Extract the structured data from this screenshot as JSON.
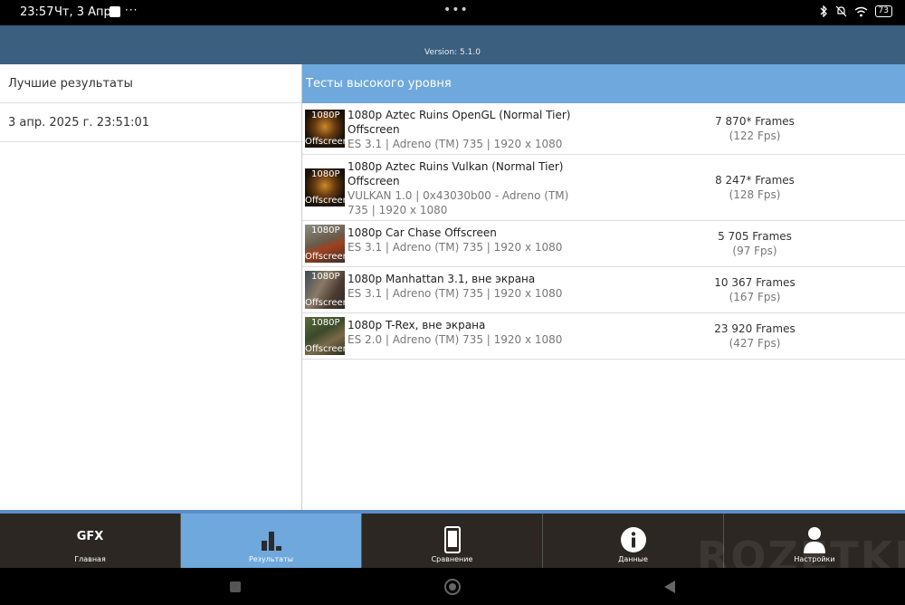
{
  "statusbar": {
    "time": "23:57",
    "date": "Чт, 3 Апр",
    "more": "···",
    "dots": "•••",
    "battery": "73"
  },
  "header": {
    "version": "Version: 5.1.0"
  },
  "left": {
    "title": "Лучшие результаты",
    "date": "3 апр. 2025 г. 23:51:01"
  },
  "right": {
    "title": "Тесты высокого уровня",
    "tests": [
      {
        "thumb_top": "1080P",
        "thumb_bottom": "Offscreen",
        "name": "1080p Aztec Ruins OpenGL (Normal Tier) Offscreen",
        "sub": "ES 3.1 | Adreno (TM) 735 | 1920 x 1080",
        "frames": "7 870* Frames",
        "fps": "(122 Fps)"
      },
      {
        "thumb_top": "1080P",
        "thumb_bottom": "Offscreen",
        "name": "1080p Aztec Ruins Vulkan (Normal Tier) Offscreen",
        "sub": "VULKAN 1.0 | 0x43030b00 - Adreno (TM) 735 | 1920 x 1080",
        "frames": "8 247* Frames",
        "fps": "(128 Fps)"
      },
      {
        "thumb_top": "1080P",
        "thumb_bottom": "Offscreen",
        "name": "1080p Car Chase Offscreen",
        "sub": "ES 3.1 | Adreno (TM) 735 | 1920 x 1080",
        "frames": "5 705 Frames",
        "fps": "(97 Fps)"
      },
      {
        "thumb_top": "1080P",
        "thumb_bottom": "Offscreen",
        "name": "1080p Manhattan 3.1, вне экрана",
        "sub": "ES 3.1 | Adreno (TM) 735 | 1920 x 1080",
        "frames": "10 367 Frames",
        "fps": "(167 Fps)"
      },
      {
        "thumb_top": "1080P",
        "thumb_bottom": "Offscreen",
        "name": "1080p T-Rex, вне экрана",
        "sub": "ES 2.0 | Adreno (TM) 735 | 1920 x 1080",
        "frames": "23 920 Frames",
        "fps": "(427 Fps)"
      }
    ]
  },
  "nav": {
    "gfx_logo": "GFX",
    "items": [
      {
        "label": "Главная",
        "icon": "gfx-logo-icon"
      },
      {
        "label": "Результаты",
        "icon": "bar-chart-icon"
      },
      {
        "label": "Сравнение",
        "icon": "phone-icon"
      },
      {
        "label": "Данные",
        "icon": "info-icon"
      },
      {
        "label": "Настройки",
        "icon": "user-icon"
      }
    ]
  },
  "watermark": "ROZETKED",
  "colors": {
    "header": "#3a5f7f",
    "accent": "#6ea8dc",
    "navbar": "#2c2722"
  }
}
